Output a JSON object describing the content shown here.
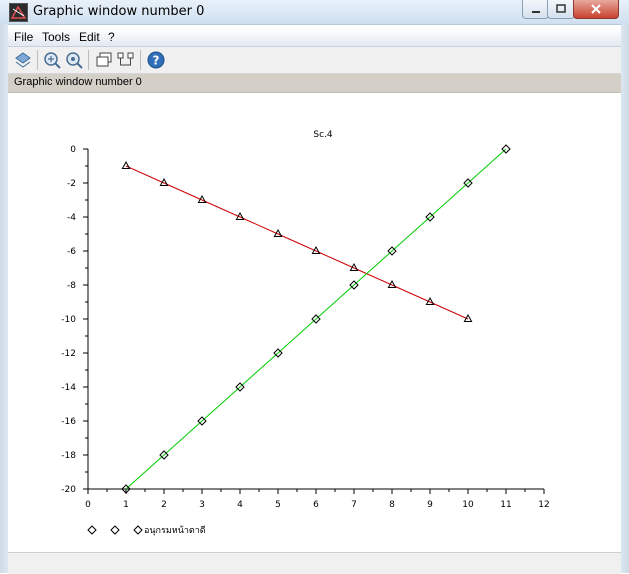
{
  "window": {
    "title": "Graphic window number 0"
  },
  "menu": {
    "items": [
      "File",
      "Tools",
      "Edit",
      "?"
    ]
  },
  "toolbar": {
    "buttons": [
      "rotate-icon",
      "zoom-in-icon",
      "zoom-out-icon",
      "window-icon",
      "datatip-icon",
      "help-icon"
    ]
  },
  "infobar": {
    "text": "Graphic window number 0"
  },
  "chart_data": {
    "type": "line",
    "title": "Sc.4",
    "xlim": [
      0,
      12
    ],
    "ylim": [
      -20,
      0
    ],
    "x_ticks": [
      0,
      1,
      2,
      3,
      4,
      5,
      6,
      7,
      8,
      9,
      10,
      11,
      12
    ],
    "y_ticks": [
      0,
      -2,
      -4,
      -6,
      -8,
      -10,
      -12,
      -14,
      -16,
      -18,
      -20
    ],
    "series": [
      {
        "color": "#cc0000",
        "marker": "triangle",
        "x": [
          1,
          2,
          3,
          4,
          5,
          6,
          7,
          8,
          9,
          10
        ],
        "y": [
          -1,
          -2,
          -3,
          -4,
          -5,
          -6,
          -7,
          -8,
          -9,
          -10
        ]
      },
      {
        "color": "#00cc00",
        "marker": "diamond",
        "x": [
          1,
          2,
          3,
          4,
          5,
          6,
          7,
          8,
          9,
          10,
          11
        ],
        "y": [
          -20,
          -18,
          -16,
          -14,
          -12,
          -10,
          -8,
          -6,
          -4,
          -2,
          0
        ]
      }
    ],
    "legend": {
      "placement": "bottom-left",
      "text": "อนุกรมหน้าตาดี"
    }
  }
}
